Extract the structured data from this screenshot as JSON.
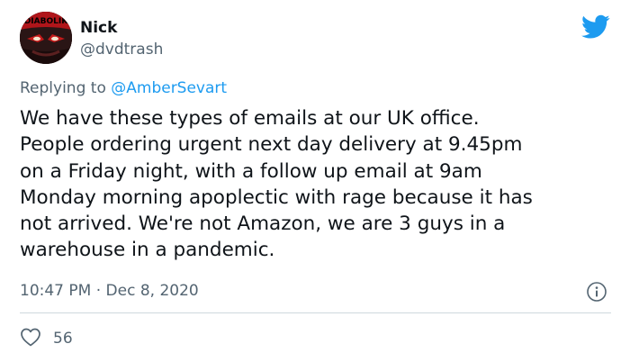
{
  "author": {
    "name": "Nick",
    "handle": "@dvdtrash",
    "avatar_text": "DIABOLIK"
  },
  "reply": {
    "prefix": "Replying to",
    "mention": "@AmberSevart"
  },
  "tweet": {
    "lines": [
      "We have these types of emails at our UK office.",
      "People ordering urgent next day delivery at 9.45pm",
      "on a Friday night, with a follow up email at 9am",
      "Monday morning apoplectic with rage because it has",
      "not arrived. We're not Amazon, we are 3 guys in a",
      "warehouse in a pandemic."
    ]
  },
  "meta": {
    "time": "10:47 PM",
    "separator": "·",
    "date": "Dec 8, 2020"
  },
  "engagement": {
    "likes": "56"
  },
  "icons": {
    "logo": "twitter-bird-icon",
    "info": "info-icon",
    "like": "heart-icon"
  },
  "colors": {
    "brand": "#1d9bf0",
    "text": "#0f1419",
    "muted": "#536471",
    "divider": "#cfd9de"
  }
}
